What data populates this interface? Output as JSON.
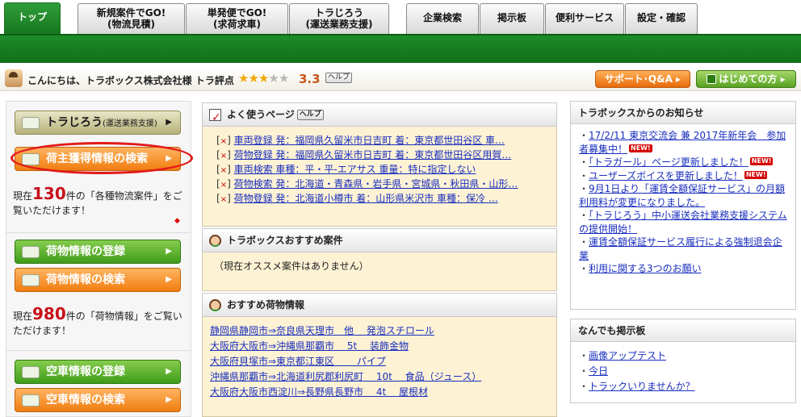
{
  "tabs": [
    {
      "l1": "トップ",
      "l2": ""
    },
    {
      "l1": "新規案件でGO!",
      "l2": "(物流見積)"
    },
    {
      "l1": "単発便でGO!",
      "l2": "(求荷求車)"
    },
    {
      "l1": "トラじろう",
      "l2": "(運送業務支援)"
    },
    {
      "l1": "企業検索",
      "l2": ""
    },
    {
      "l1": "掲示板",
      "l2": ""
    },
    {
      "l1": "便利サービス",
      "l2": ""
    },
    {
      "l1": "設定・確認",
      "l2": ""
    }
  ],
  "user": {
    "greeting": "こんにちは、トラボックス株式会社様 トラ評点",
    "score": "3.3",
    "help": "ヘルプ"
  },
  "header_buttons": {
    "support": "サポート･Q&A",
    "first": "はじめての方"
  },
  "left": {
    "torajiro": "トラじろう",
    "torajiro_sub": "(運送業務支援)",
    "shipper_search": "荷主獲得情報の検索",
    "count1_pre": "現在",
    "count1": "130",
    "count1_post": "件の「各種物流案件」をご覧いただけます！",
    "cargo_register": "荷物情報の登録",
    "cargo_search": "荷物情報の検索",
    "count2_pre": "現在",
    "count2": "980",
    "count2_post": "件の「荷物情報」をご覧いただけます！",
    "truck_register": "空車情報の登録",
    "truck_search": "空車情報の検索"
  },
  "history": {
    "title": "よく使うページ",
    "help": "ヘルプ",
    "x_label": "×",
    "rows": [
      "車両登録 発：福岡県久留米市日吉町 着：東京都世田谷区 車…",
      "荷物登録 発：福岡県久留米市日吉町 着：東京都世田谷区用賀…",
      "車両検索 車種：平・平-エアサス 重量：特に指定しない",
      "荷物検索 発：北海道・青森県・岩手県・宮城県・秋田県・山形…",
      "荷物登録 発：北海道小樽市 着：山形県米沢市 車種：保冷 …"
    ]
  },
  "recommend": {
    "title": "トラボックスおすすめ案件",
    "empty": "（現在オススメ案件はありません）"
  },
  "cargo": {
    "title": "おすすめ荷物情報",
    "rows": [
      "静岡県静岡市⇒奈良県天理市　他　 発泡スチロール",
      "大阪府大阪市⇒沖縄県那覇市　 5t　 装飾金物",
      "大阪府貝塚市⇒東京都江東区　　 パイプ",
      "沖縄県那覇市⇒北海道利尻郡利尻町　 10t　 食品（ジュース）",
      "大阪府大阪市西淀川⇒長野県長野市　 4t　 屋根材"
    ]
  },
  "news": {
    "title": "トラボックスからのお知らせ",
    "items": [
      {
        "text": "17/2/11 東京交流会 兼 2017年新年会　参加者募集中！",
        "new": "NEW!"
      },
      {
        "text": "「トラガール」ページ更新しました！",
        "new": "NEW!"
      },
      {
        "text": "ユーザーズボイスを更新しました！",
        "new": "NEW!"
      },
      {
        "text": "9月1日より「運賃全額保証サービス」の月額利用料が変更になりました。",
        "new": ""
      },
      {
        "text": "「トラじろう」中小運送会社業務支援システムの提供開始！",
        "new": ""
      },
      {
        "text": "運賃全額保証サービス履行による強制退会企業",
        "new": ""
      },
      {
        "text": "利用に関する3つのお願い",
        "new": ""
      }
    ]
  },
  "board": {
    "title": "なんでも掲示板",
    "items": [
      "画像アップテスト",
      "今日",
      "トラックいりませんか？"
    ]
  },
  "colors": {
    "brand_green": "#17781f",
    "accent_orange": "#f07d10",
    "link": "#1a2fbe"
  },
  "icons": [
    "user-avatar-icon",
    "star-icon",
    "truck-icon",
    "handshake-icon",
    "cargo-box-icon",
    "checklist-icon",
    "person-face-icon"
  ]
}
